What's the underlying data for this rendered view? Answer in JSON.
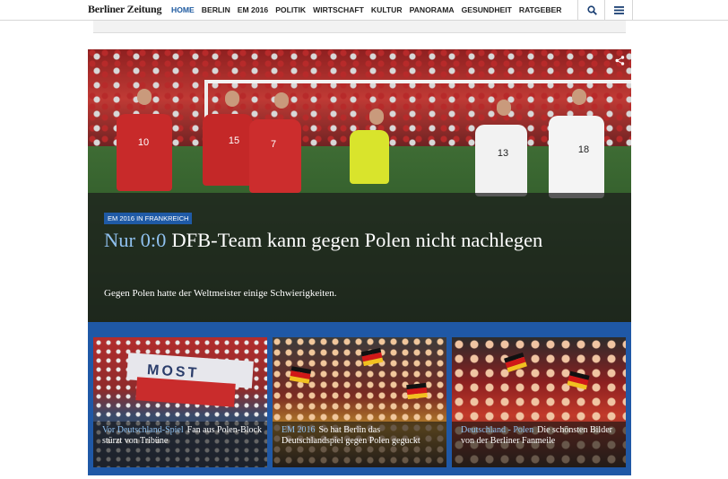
{
  "site": {
    "logo_text": "Berliner Zeitung",
    "nav": [
      "HOME",
      "BERLIN",
      "EM 2016",
      "POLITIK",
      "WIRTSCHAFT",
      "KULTUR",
      "PANORAMA",
      "GESUNDHEIT",
      "RATGEBER"
    ],
    "active_nav": "HOME",
    "search_icon": "search-icon",
    "menu_icon": "hamburger-menu-icon"
  },
  "hero": {
    "tag": "EM 2016 IN FRANKREICH",
    "kicker": "Nur 0:0",
    "headline": "DFB-Team kann gegen Polen nicht nachlegen",
    "teaser": "Gegen Polen hatte der Weltmeister einige Schwierigkeiten.",
    "share_icon": "share-icon",
    "jersey_numbers": [
      "10",
      "15",
      "7",
      "13",
      "18"
    ]
  },
  "cards": [
    {
      "kicker": "Vor Deutschland-Spiel",
      "title": "Fan aus Polen-Block stürzt von Tribüne",
      "banner_text": "MOST"
    },
    {
      "kicker": "EM 2016",
      "title": "So hat Berlin das Deutschlandspiel gegen Polen geguckt"
    },
    {
      "kicker": "Deutschland - Polen",
      "title": "Die schönsten Bilder von der Berliner Fanmeile"
    }
  ],
  "colors": {
    "accent": "#1e5aa0",
    "kicker": "#8fc0ee",
    "row_background": "#1f58a6"
  }
}
